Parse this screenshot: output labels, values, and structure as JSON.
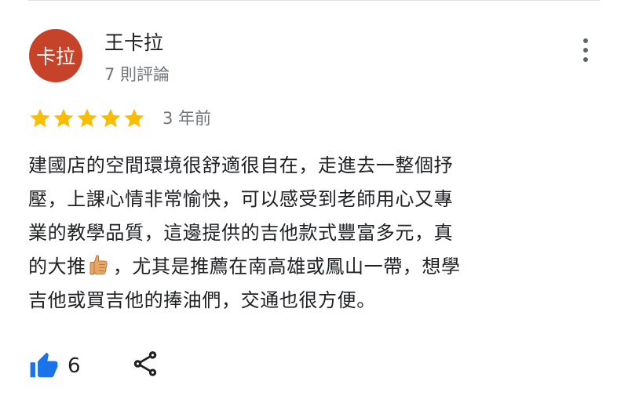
{
  "reviewer": {
    "avatar_text": "卡拉",
    "name": "王卡拉",
    "meta": "7 則評論"
  },
  "review": {
    "rating": 5,
    "rating_max": 5,
    "time_ago": "3 年前",
    "lines": {
      "l1": "建國店的空間環境很舒適很自在，走進去一整個抒",
      "l2": "壓，上課心情非常愉快，可以感受到老師用心又專",
      "l3": "業的教學品質，這邊提供的吉他款式豐富多元，真",
      "l4_before": "的大推",
      "l4_after": "，尤其是推薦在南高雄或鳳山一帶，想學",
      "l5": "吉他或買吉他的捧油們，交通也很方便。"
    }
  },
  "actions": {
    "like_count": "6",
    "like_icon": "thumb-up-icon",
    "share_icon": "share-icon",
    "more_icon": "more-vert-icon"
  },
  "colors": {
    "avatar_bg": "#c6432a",
    "star": "#fbbc04",
    "like": "#1a73e8",
    "secondary_text": "#70757a"
  }
}
